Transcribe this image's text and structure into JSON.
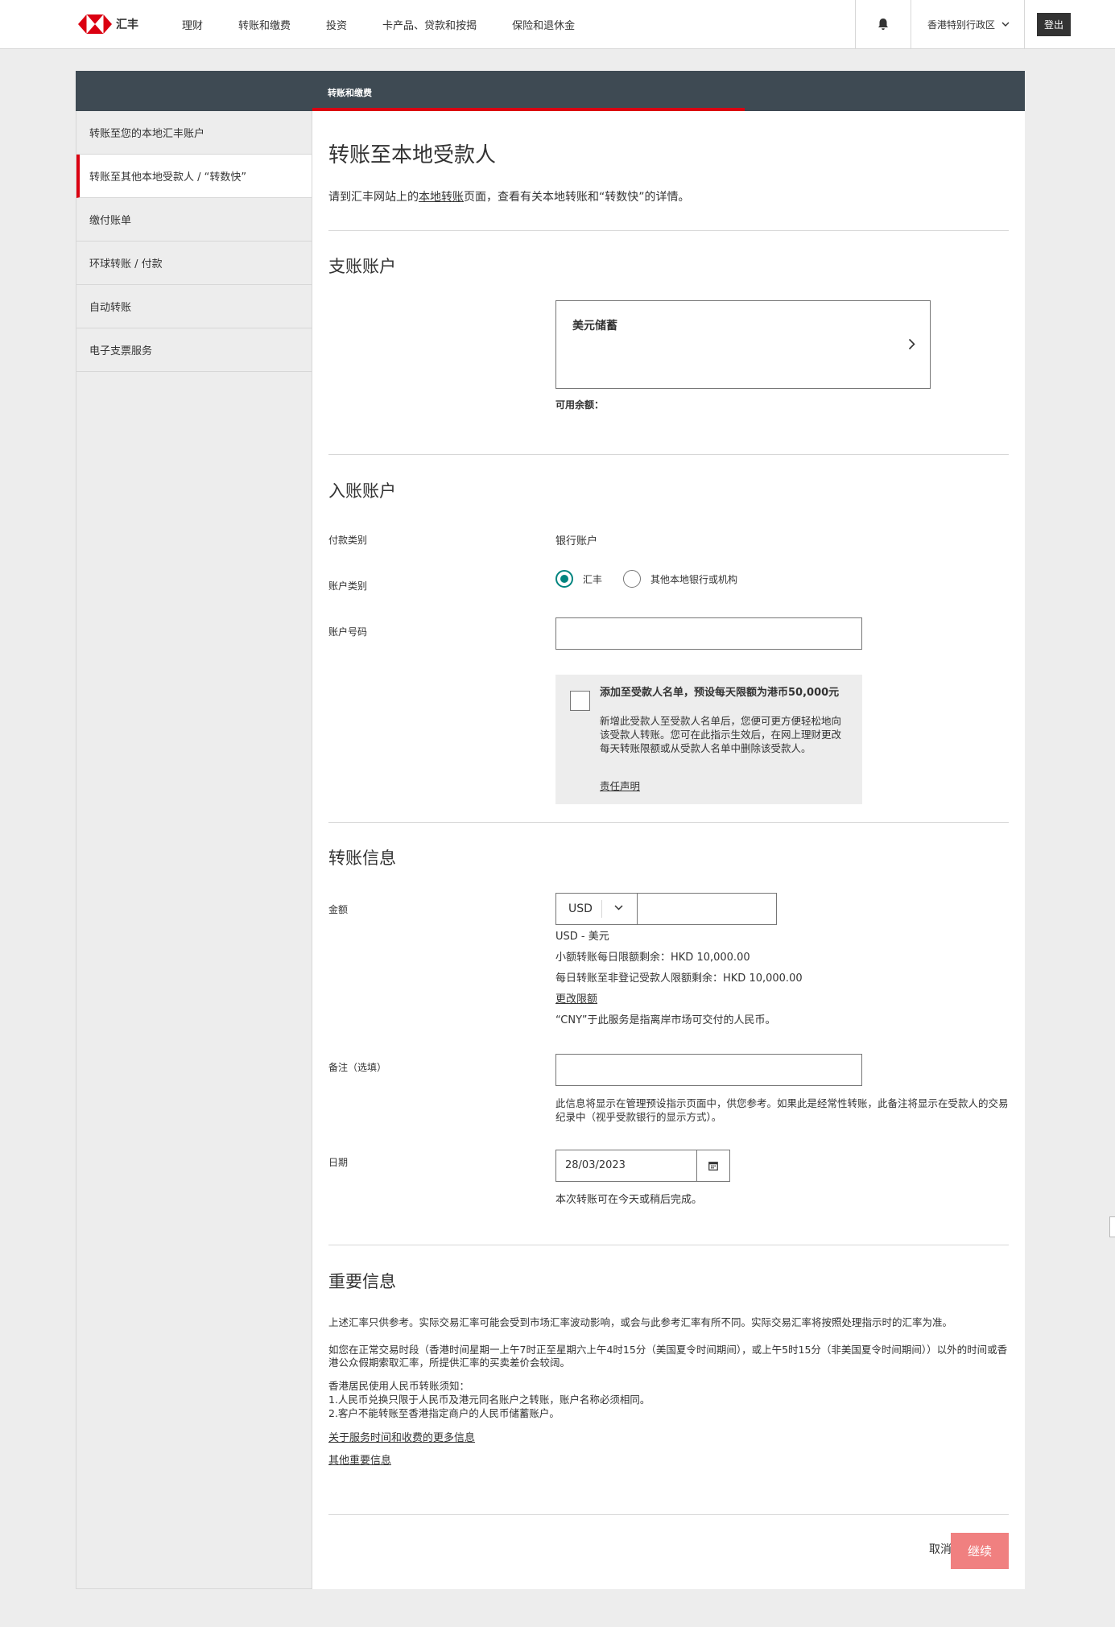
{
  "brand": {
    "logo_text": "汇丰",
    "colors": {
      "red": "#db0011",
      "dark": "#3e4a53",
      "teal": "#00847f",
      "continue_disabled": "#f08080"
    }
  },
  "topnav": {
    "items": [
      "理财",
      "转账和缴费",
      "投资",
      "卡产品、贷款和按揭",
      "保险和退休金"
    ],
    "region": "香港特别行政区",
    "logout": "登出"
  },
  "page_header": {
    "title": "转账和缴费"
  },
  "sidebar": {
    "items": [
      {
        "label": "转账至您的本地汇丰账户"
      },
      {
        "label": "转账至其他本地受款人 / “转数快”",
        "active": true
      },
      {
        "label": "缴付账单"
      },
      {
        "label": "环球转账 / 付款"
      },
      {
        "label": "自动转账"
      },
      {
        "label": "电子支票服务"
      }
    ]
  },
  "main": {
    "title": "转账至本地受款人",
    "intro": {
      "before": "请到汇丰网站上的",
      "link": "本地转账",
      "after": "页面，查看有关本地转账和“转数快”的详情。"
    },
    "from_section": {
      "title": "支账账户",
      "account_name": "美元储蓄",
      "available_label": "可用余额："
    },
    "to_section": {
      "title": "入账账户",
      "payment_type_label": "付款类别",
      "payment_type_value": "银行账户",
      "account_type_label": "账户类别",
      "account_type_options": [
        {
          "label": "汇丰",
          "selected": true
        },
        {
          "label": "其他本地银行或机构",
          "selected": false
        }
      ],
      "account_number_label": "账户号码",
      "account_number_value": "",
      "add_payee": {
        "title": "添加至受款人名单，预设每天限额为港币50,000元",
        "desc": "新增此受款人至受款人名单后，您便可更方便轻松地向该受款人转账。您可在此指示生效后，在网上理财更改每天转账限额或从受款人名单中删除该受款人。",
        "link": "责任声明"
      }
    },
    "transfer_section": {
      "title": "转账信息",
      "amount_label": "金额",
      "currency": "USD",
      "amount_value": "",
      "currency_desc": "USD - 美元",
      "limit_small": "小额转账每日限额剩余：HKD 10,000.00",
      "limit_unregistered": "每日转账至非登记受款人限额剩余：HKD 10,000.00",
      "change_limit": "更改限额",
      "cny_note": "“CNY”于此服务是指离岸市场可交付的人民币。",
      "memo_label": "备注（选填）",
      "memo_value": "",
      "memo_note": "此信息将显示在管理预设指示页面中，供您参考。如果此是经常性转账，此备注将显示在受款人的交易纪录中（视乎受款银行的显示方式）。",
      "date_label": "日期",
      "date_value": "28/03/2023",
      "date_note": "本次转账可在今天或稍后完成。"
    },
    "important_section": {
      "title": "重要信息",
      "para1": "上述汇率只供参考。实际交易汇率可能会受到市场汇率波动影响，或会与此参考汇率有所不同。实际交易汇率将按照处理指示时的汇率为准。",
      "para2": "如您在正常交易时段（香港时间星期一上午7时正至星期六上午4时15分（美国夏令时间期间），或上午5时15分（非美国夏令时间期间））以外的时间或香港公众假期索取汇率，所提供汇率的买卖差价会较阔。",
      "rmb_title": "香港居民使用人民币转账须知：",
      "rmb_1": "1.人民币兑换只限于人民币及港元同名账户之转账，账户名称必须相同。",
      "rmb_2": "2.客户不能转账至香港指定商户的人民币储蓄账户。",
      "link1": "关于服务时间和收费的更多信息",
      "link2": "其他重要信息"
    },
    "actions": {
      "cancel": "取消",
      "continue": "继续"
    }
  }
}
